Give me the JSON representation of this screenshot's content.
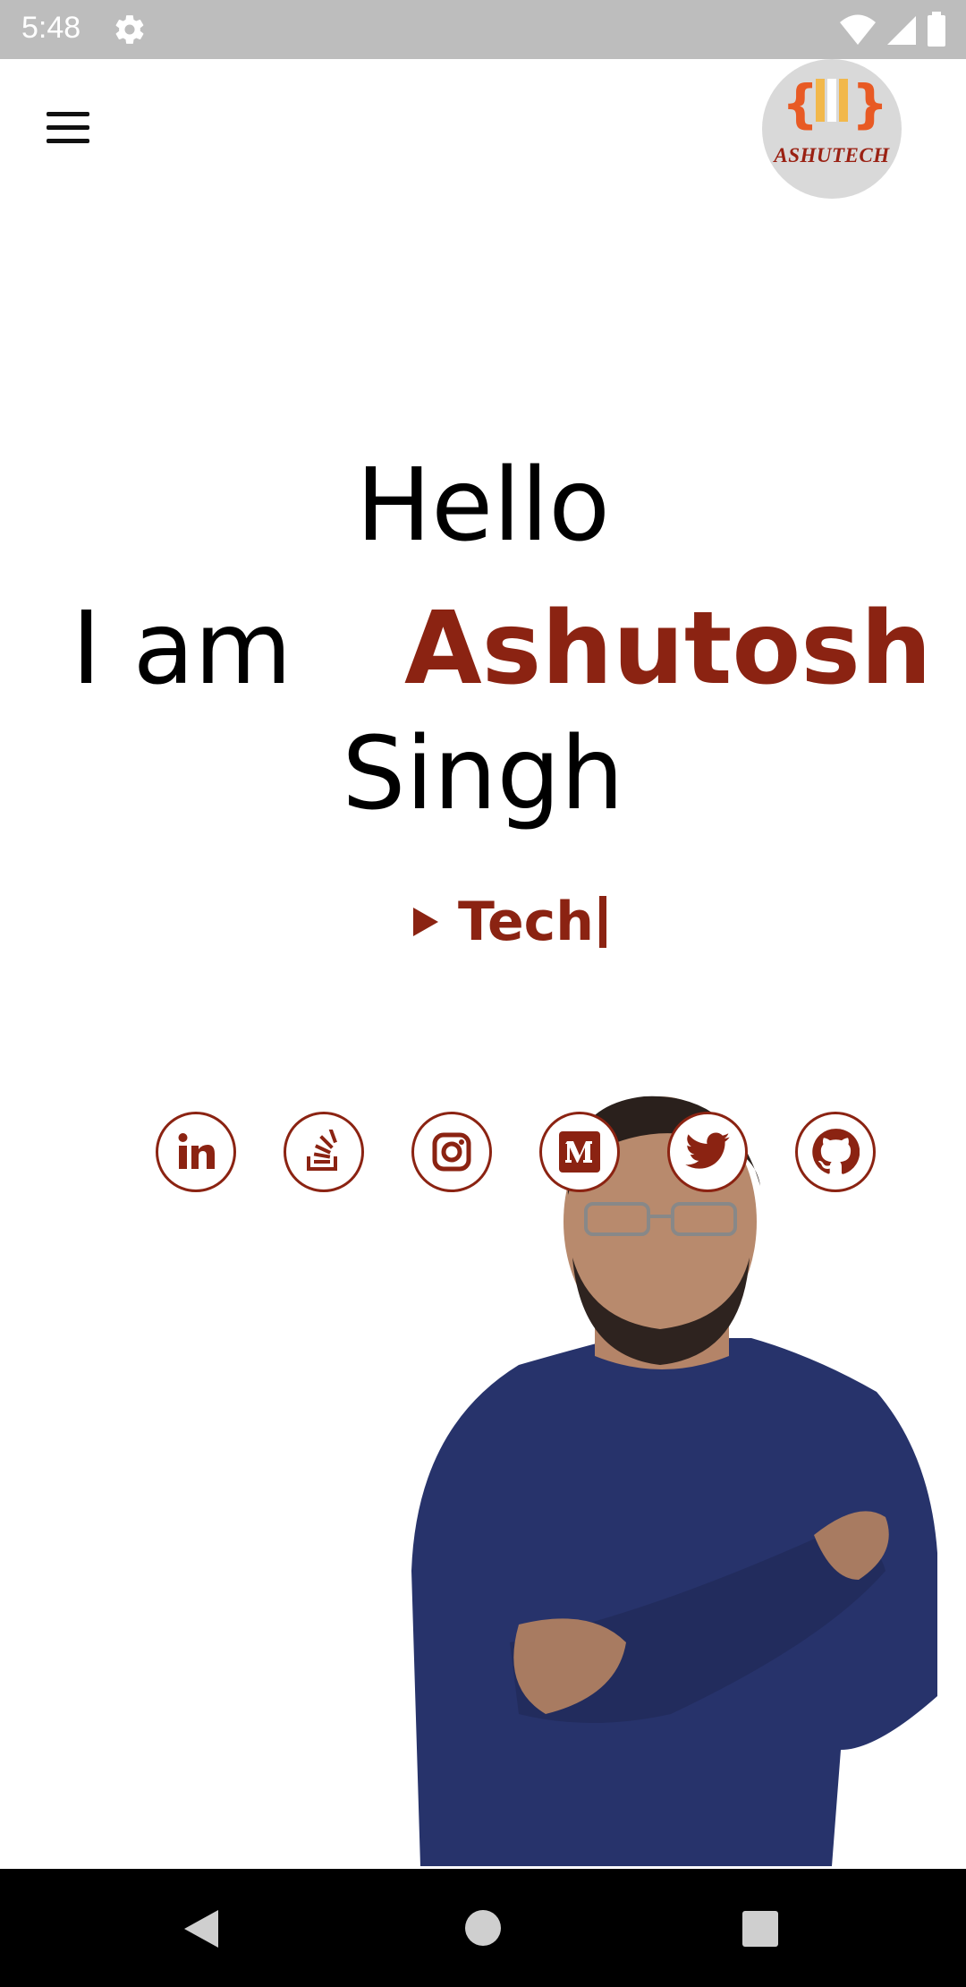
{
  "status_bar": {
    "time": "5:48",
    "icons": [
      "settings-icon",
      "wifi-icon",
      "signal-icon",
      "battery-icon"
    ]
  },
  "header": {
    "menu_icon": "hamburger-icon",
    "logo_text": "ASHUTECH"
  },
  "hero": {
    "greeting": "Hello",
    "intro": "I am",
    "first_name": "Ashutosh",
    "last_name": "Singh",
    "typing_text": "Tech"
  },
  "social_links": [
    {
      "name": "linkedin-icon"
    },
    {
      "name": "stackoverflow-icon"
    },
    {
      "name": "instagram-icon"
    },
    {
      "name": "medium-icon"
    },
    {
      "name": "twitter-icon"
    },
    {
      "name": "github-icon"
    }
  ],
  "nav_bar": {
    "buttons": [
      "back-icon",
      "home-icon",
      "recents-icon"
    ]
  },
  "colors": {
    "accent": "#8b2312",
    "status_bar": "#bdbdbd",
    "logo_bg": "#d9d9d9",
    "nav_bar": "#000000"
  }
}
